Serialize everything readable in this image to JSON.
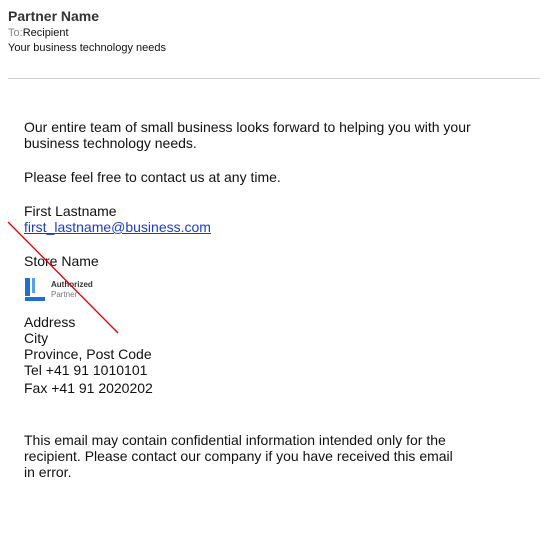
{
  "email": {
    "sender": "Partner Name",
    "to_label": "To:",
    "to_value": "Recipient",
    "subject": "Your business technology needs"
  },
  "body": {
    "intro_line1": "Our entire team of small business looks forward to helping you with your",
    "intro_line2": "business technology needs.",
    "contact": "Please feel free to contact us at any time.",
    "signature": {
      "name": "First Lastname",
      "email": "first_lastname@business.com",
      "store": "Store Name",
      "badge_line1": "Authorized",
      "badge_line2": "Partner",
      "address": "Address",
      "city": "City",
      "province": "Province, Post Code",
      "tel": "Tel +41 91 1010101",
      "fax": "Fax +41 91 2020202"
    },
    "disclaimer_line1": "This email may contain confidential information intended only for the",
    "disclaimer_line2": "recipient. Please contact our company if you have received this email",
    "disclaimer_line3": "in error."
  },
  "colors": {
    "link": "#1a3cc8",
    "logo_blue": "#1e6fd1",
    "annotation_line": "#e60000",
    "divider": "#cfcfcf"
  },
  "icons": {
    "logo": "authorized-partner-logo"
  }
}
